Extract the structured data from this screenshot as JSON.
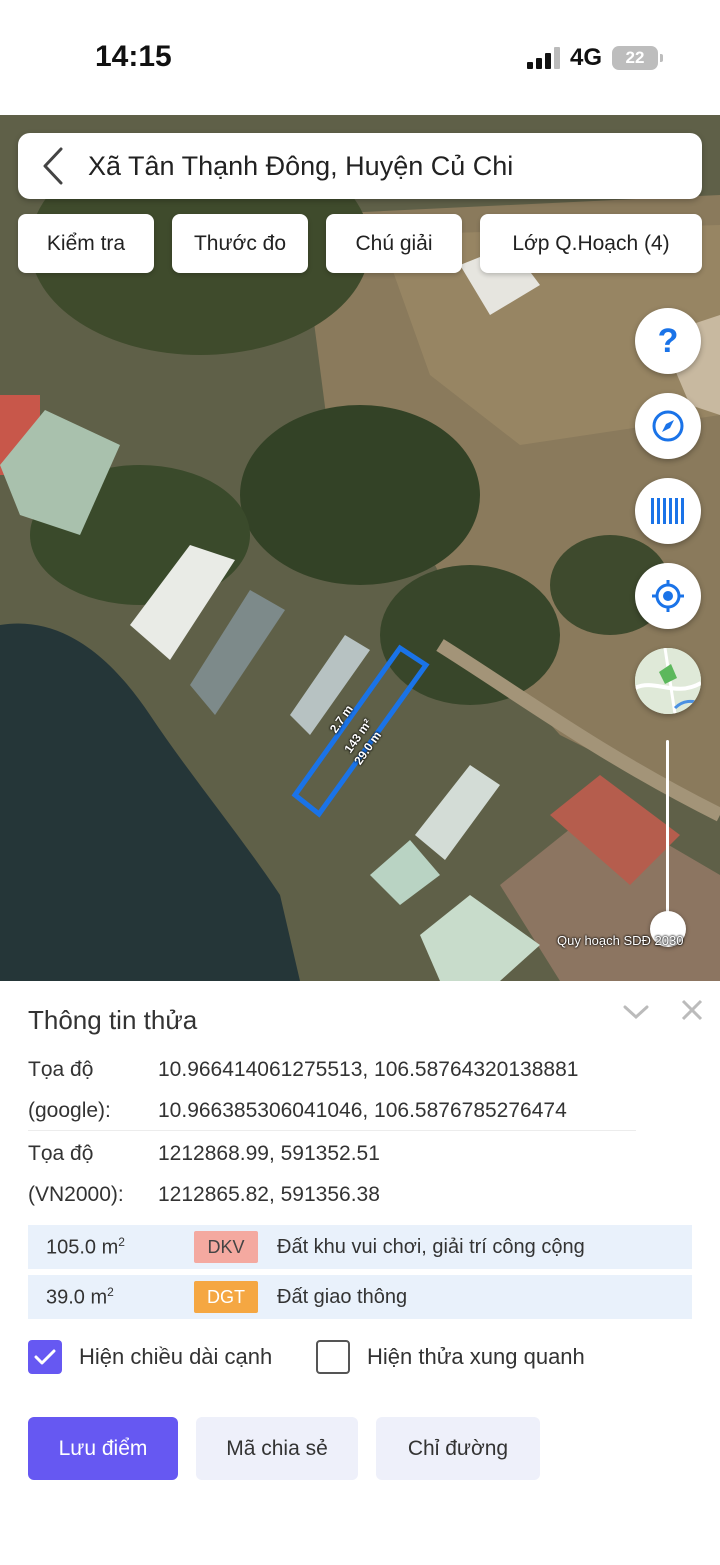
{
  "status_bar": {
    "time": "14:15",
    "network": "4G",
    "battery": "22"
  },
  "map": {
    "location_title": "Xã Tân Thạnh Đông, Huyện Củ Chi",
    "chips": [
      "Kiểm tra",
      "Thước đo",
      "Chú giải",
      "Lớp Q.Hoạch (4)"
    ],
    "help_glyph": "?",
    "parcel_labels": {
      "side_short": "2.7 m",
      "area": "143 m²",
      "side_long": "29.0 m"
    },
    "planning_caption": "Quy hoạch SDĐ 2030",
    "accent_color": "#1a73e8"
  },
  "info": {
    "title": "Thông tin thửa",
    "coord_google_label_1": "Tọa độ",
    "coord_google_label_2": "(google):",
    "coord_google_1": "10.966414061275513, 106.58764320138881",
    "coord_google_2": "10.966385306041046, 106.5876785276474",
    "coord_vn_label_1": "Tọa độ",
    "coord_vn_label_2": "(VN2000):",
    "coord_vn_1": "1212868.99, 591352.51",
    "coord_vn_2": "1212865.82, 591356.38",
    "land_uses": [
      {
        "area": "105.0 m",
        "unit_sup": "2",
        "code": "DKV",
        "code_color": "#f4a9a0",
        "code_text_color": "#444",
        "description": "Đất khu vui chơi, giải trí công cộng"
      },
      {
        "area": "39.0 m",
        "unit_sup": "2",
        "code": "DGT",
        "code_color": "#f5a742",
        "code_text_color": "#fff",
        "description": "Đất giao thông"
      }
    ],
    "show_edge_length": {
      "label": "Hiện chiều dài cạnh",
      "checked": true
    },
    "show_neighbors": {
      "label": "Hiện thửa xung quanh",
      "checked": false
    },
    "buttons": {
      "save": "Lưu điểm",
      "share": "Mã chia sẻ",
      "directions": "Chỉ đường"
    },
    "primary_color": "#6658f2"
  }
}
